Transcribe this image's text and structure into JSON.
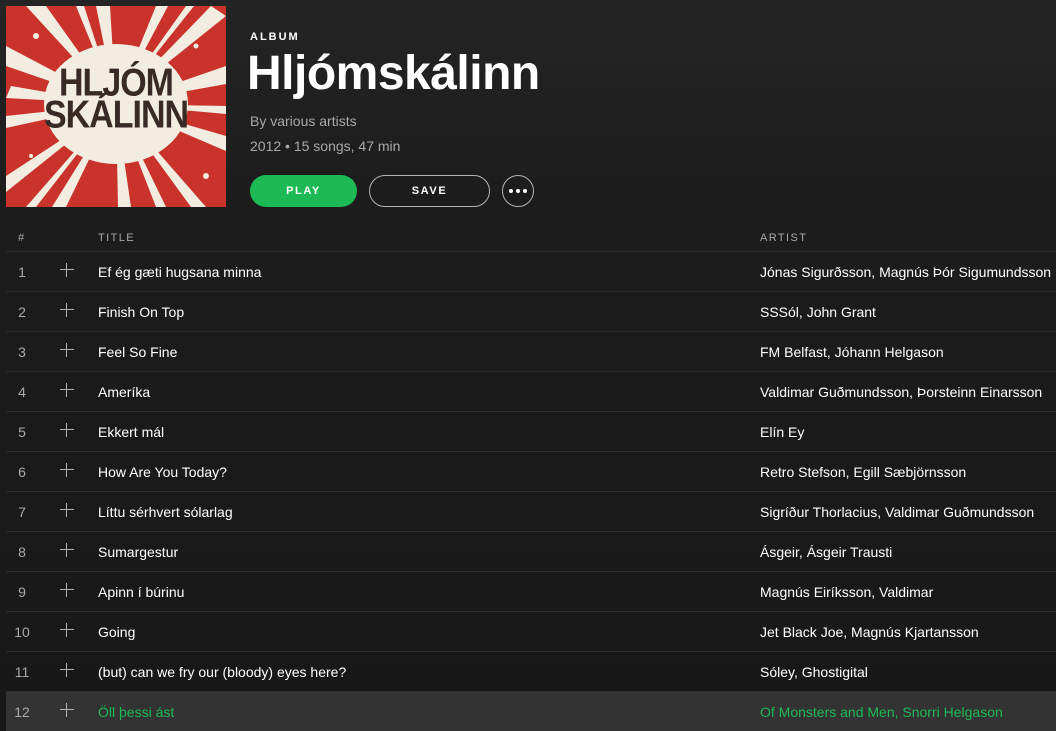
{
  "album": {
    "type_label": "ALBUM",
    "title": "Hljómskálinn",
    "byline": "By various artists",
    "meta": "2012 • 15 songs, 47 min",
    "cover": {
      "line1": "HLJÓM",
      "line2": "SKÁLINN",
      "bg_color": "#c9332b"
    }
  },
  "actions": {
    "play_label": "PLAY",
    "save_label": "SAVE",
    "more_icon": "more-dots-icon"
  },
  "colors": {
    "accent": "#1db954",
    "background": "#181818",
    "muted_text": "#a9a9a9"
  },
  "table": {
    "columns": {
      "num": "#",
      "title": "TITLE",
      "artist": "ARTIST"
    },
    "active_index": 11,
    "tracks": [
      {
        "num": "1",
        "title": "Ef ég gæti hugsana minna",
        "artist": "Jónas Sigurðsson, Magnús Þór Sigumundsson"
      },
      {
        "num": "2",
        "title": "Finish On Top",
        "artist": "SSSól, John Grant"
      },
      {
        "num": "3",
        "title": "Feel So Fine",
        "artist": "FM Belfast, Jóhann Helgason"
      },
      {
        "num": "4",
        "title": "Ameríka",
        "artist": "Valdimar Guðmundsson, Þorsteinn Einarsson"
      },
      {
        "num": "5",
        "title": "Ekkert mál",
        "artist": "Elín Ey"
      },
      {
        "num": "6",
        "title": "How Are You Today?",
        "artist": "Retro Stefson, Egill Sæbjörnsson"
      },
      {
        "num": "7",
        "title": "Líttu sérhvert sólarlag",
        "artist": "Sigríður Thorlacius, Valdimar Guðmundsson"
      },
      {
        "num": "8",
        "title": "Sumargestur",
        "artist": "Ásgeir, Ásgeir Trausti"
      },
      {
        "num": "9",
        "title": "Apinn í búrinu",
        "artist": "Magnús Eiríksson, Valdimar"
      },
      {
        "num": "10",
        "title": "Going",
        "artist": "Jet Black Joe, Magnús Kjartansson"
      },
      {
        "num": "11",
        "title": "(but) can we fry our (bloody) eyes here?",
        "artist": "Sóley, Ghostigital"
      },
      {
        "num": "12",
        "title": "Öll þessi ást",
        "artist": "Of Monsters and Men, Snorri Helgason"
      }
    ]
  }
}
